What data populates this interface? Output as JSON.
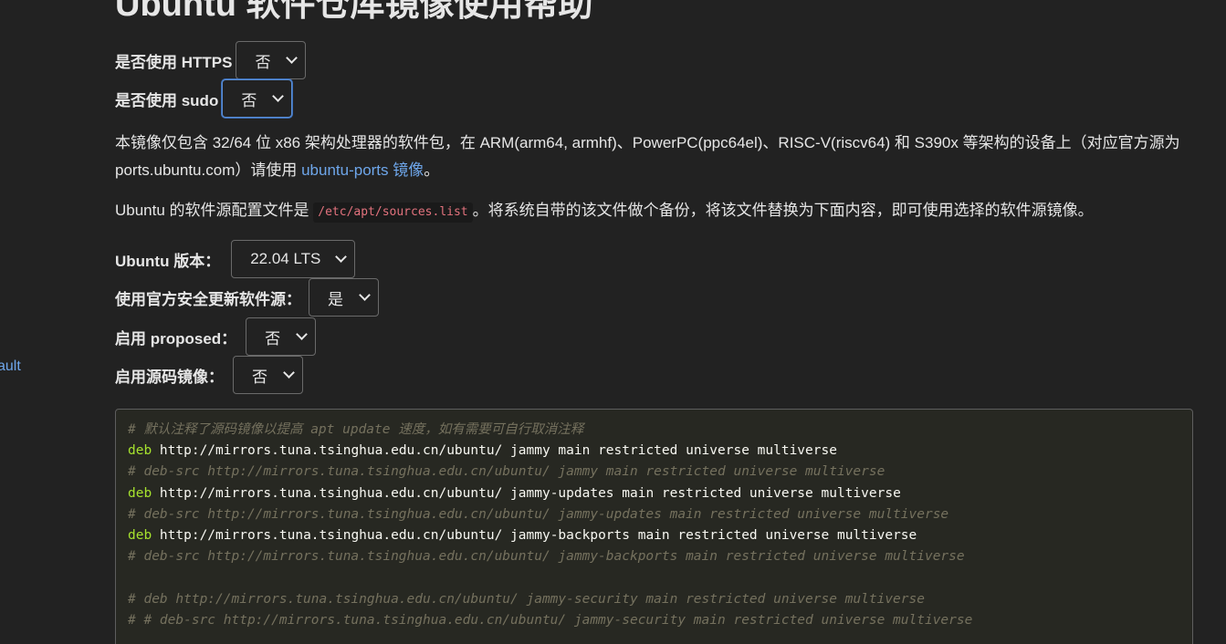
{
  "title": "Ubuntu 软件仓库镜像使用帮助",
  "sidebar": {
    "partial_link": "ault"
  },
  "options_top": {
    "https": {
      "label": "是否使用 HTTPS",
      "value": "否"
    },
    "sudo": {
      "label": "是否使用 sudo",
      "value": "否"
    }
  },
  "intro": {
    "text_before_link": "本镜像仅包含 32/64 位 x86 架构处理器的软件包，在 ARM(arm64, armhf)、PowerPC(ppc64el)、RISC-V(riscv64) 和 S390x 等架构的设备上（对应官方源为 ports.ubuntu.com）请使用 ",
    "link": "ubuntu-ports 镜像",
    "text_after_link": "。"
  },
  "config": {
    "before": "Ubuntu 的软件源配置文件是 ",
    "path": "/etc/apt/sources.list",
    "after": "。将系统自带的该文件做个备份，将该文件替换为下面内容，即可使用选择的软件源镜像。"
  },
  "options": {
    "version": {
      "label": "Ubuntu 版本：",
      "value": "22.04 LTS"
    },
    "security": {
      "label": "使用官方安全更新软件源：",
      "value": "是"
    },
    "proposed": {
      "label": "启用 proposed：",
      "value": "否"
    },
    "source": {
      "label": "启用源码镜像：",
      "value": "否"
    }
  },
  "code": {
    "line1": "# 默认注释了源码镜像以提高 apt update 速度，如有需要可自行取消注释",
    "line2_kw": "deb",
    "line2_rest": " http://mirrors.tuna.tsinghua.edu.cn/ubuntu/ jammy main restricted universe multiverse",
    "line3": "# deb-src http://mirrors.tuna.tsinghua.edu.cn/ubuntu/ jammy main restricted universe multiverse",
    "line4_kw": "deb",
    "line4_rest": " http://mirrors.tuna.tsinghua.edu.cn/ubuntu/ jammy-updates main restricted universe multiverse",
    "line5": "# deb-src http://mirrors.tuna.tsinghua.edu.cn/ubuntu/ jammy-updates main restricted universe multiverse",
    "line6_kw": "deb",
    "line6_rest": " http://mirrors.tuna.tsinghua.edu.cn/ubuntu/ jammy-backports main restricted universe multiverse",
    "line7": "# deb-src http://mirrors.tuna.tsinghua.edu.cn/ubuntu/ jammy-backports main restricted universe multiverse",
    "line8": "",
    "line9": "# deb http://mirrors.tuna.tsinghua.edu.cn/ubuntu/ jammy-security main restricted universe multiverse",
    "line10": "# # deb-src http://mirrors.tuna.tsinghua.edu.cn/ubuntu/ jammy-security main restricted universe multiverse"
  },
  "colors": {
    "background": "#222222",
    "link": "#6ea6ea",
    "code_background": "#272822",
    "code_keyword": "#a6e22e",
    "code_comment": "#75715e",
    "inline_code": "#e2727d",
    "focus_ring": "#5b8fd6"
  },
  "icons": {
    "select_arrow": "chevron-down-icon"
  }
}
